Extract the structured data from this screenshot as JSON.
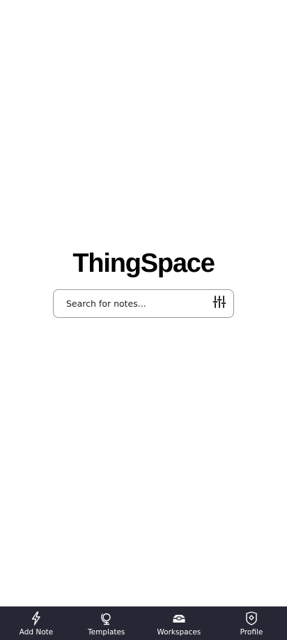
{
  "app": {
    "title": "ThingSpace"
  },
  "search": {
    "placeholder": "Search for notes...",
    "filter_icon": "sliders-icon"
  },
  "bottom_nav": {
    "background": "#252834",
    "items": [
      {
        "label": "Add Note",
        "icon": "lightning-bolt-icon"
      },
      {
        "label": "Templates",
        "icon": "globe-stand-icon"
      },
      {
        "label": "Workspaces",
        "icon": "toolbox-icon"
      },
      {
        "label": "Profile",
        "icon": "shield-badge-icon"
      }
    ]
  }
}
